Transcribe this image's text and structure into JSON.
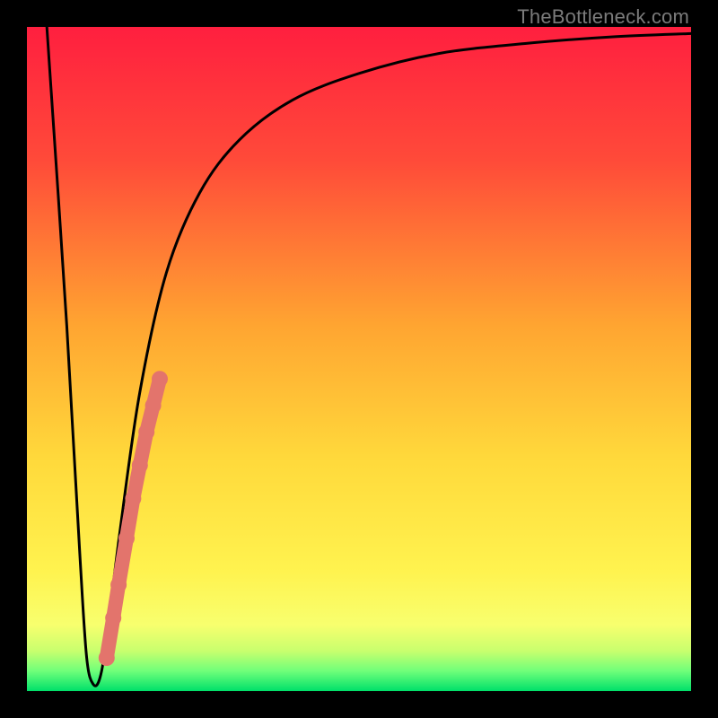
{
  "watermark": "TheBottleneck.com",
  "chart_data": {
    "type": "line",
    "title": "",
    "xlabel": "",
    "ylabel": "",
    "xlim": [
      0,
      100
    ],
    "ylim": [
      0,
      100
    ],
    "grid": false,
    "legend": false,
    "gradient_stops": [
      {
        "pos": 0,
        "color": "#ff1f3f"
      },
      {
        "pos": 20,
        "color": "#ff4a39"
      },
      {
        "pos": 45,
        "color": "#ffa531"
      },
      {
        "pos": 65,
        "color": "#ffd93b"
      },
      {
        "pos": 82,
        "color": "#fff34f"
      },
      {
        "pos": 90,
        "color": "#f8ff6e"
      },
      {
        "pos": 94,
        "color": "#c8ff6e"
      },
      {
        "pos": 97,
        "color": "#6fff7a"
      },
      {
        "pos": 100,
        "color": "#00e06a"
      }
    ],
    "series": [
      {
        "name": "bottleneck-curve",
        "color": "#000000",
        "x": [
          3,
          6,
          8,
          9,
          10,
          11,
          12,
          14,
          17,
          21,
          26,
          32,
          40,
          50,
          62,
          75,
          88,
          100
        ],
        "y": [
          100,
          55,
          20,
          5,
          1,
          2,
          8,
          24,
          45,
          63,
          75,
          83,
          89,
          93,
          96,
          97.5,
          98.5,
          99
        ]
      }
    ],
    "markers": {
      "name": "highlight-points",
      "color": "#e3746c",
      "points": [
        {
          "x": 12.0,
          "y": 5
        },
        {
          "x": 13.0,
          "y": 11
        },
        {
          "x": 13.8,
          "y": 16
        },
        {
          "x": 15.0,
          "y": 23
        },
        {
          "x": 16.0,
          "y": 29
        },
        {
          "x": 17.0,
          "y": 34
        },
        {
          "x": 18.0,
          "y": 39
        },
        {
          "x": 19.0,
          "y": 43
        },
        {
          "x": 20.0,
          "y": 47
        }
      ]
    }
  }
}
